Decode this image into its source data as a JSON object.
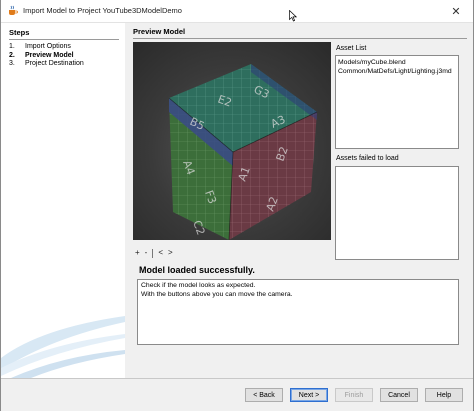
{
  "window": {
    "title": "Import Model to Project YouTube3DModelDemo",
    "close_glyph": "✕"
  },
  "steps": {
    "title": "Steps",
    "items": [
      {
        "num": "1.",
        "label": "Import Options"
      },
      {
        "num": "2.",
        "label": "Preview Model",
        "current": true
      },
      {
        "num": "3.",
        "label": "Project Destination"
      }
    ]
  },
  "main": {
    "title": "Preview Model",
    "camera_controls": [
      "+",
      "-",
      "<",
      ">"
    ],
    "asset_list": {
      "label": "Asset List",
      "items": [
        "Models/myCube.blend",
        "Common/MatDefs/Light/Lighting.j3md"
      ]
    },
    "failed_list": {
      "label": "Assets failed to load",
      "items": []
    },
    "status": "Model loaded successfully.",
    "info_lines": [
      "Check if the model looks as expected.",
      "With the buttons above you can move the camera."
    ]
  },
  "buttons": {
    "back": "< Back",
    "next": "Next >",
    "finish": "Finish",
    "cancel": "Cancel",
    "help": "Help"
  },
  "icons": {
    "app": "java-coffee-icon",
    "close": "close-icon",
    "cursor": "mouse-cursor-icon"
  },
  "colors": {
    "cube_top": "#2e6e5e",
    "cube_left": "#3c6e3a",
    "cube_right": "#6a3a44",
    "cube_band": "#3a4a8a",
    "default_button_border": "#2f6fd0"
  }
}
